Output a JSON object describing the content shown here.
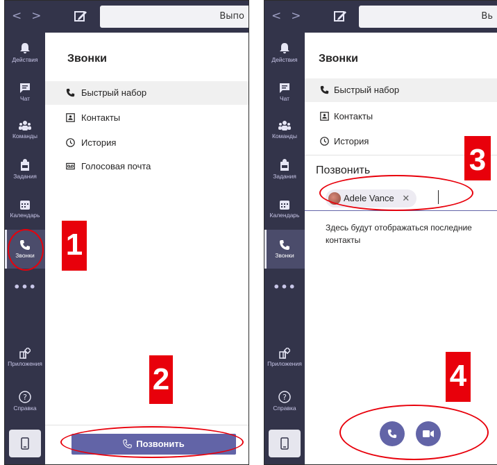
{
  "search": {
    "panel1_text": "Выпо",
    "panel2_text": "Вь"
  },
  "rail": {
    "activity": "Действия",
    "chat": "Чат",
    "teams": "Команды",
    "assignments": "Задания",
    "calendar": "Календарь",
    "calls": "Звонки",
    "more": "•••",
    "apps": "Приложения",
    "help": "Справка"
  },
  "calls": {
    "title": "Звонки",
    "menu": [
      "Быстрый набор",
      "Контакты",
      "История",
      "Голосовая почта"
    ],
    "call_button": "Позвонить"
  },
  "dial": {
    "section_title": "Позвонить",
    "chip_name": "Adele Vance",
    "chip_close": "✕",
    "hint": "Здесь будут отображаться последние контакты"
  },
  "callouts": [
    "1",
    "2",
    "3",
    "4"
  ],
  "colors": {
    "rail": "#33344a",
    "accent": "#6264a7",
    "callout": "#e8000b"
  }
}
